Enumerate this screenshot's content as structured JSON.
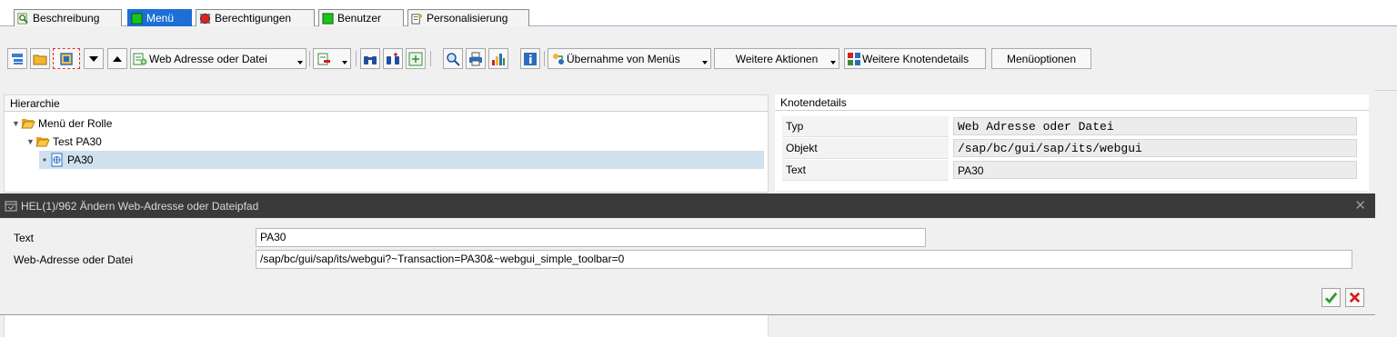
{
  "tabs": [
    {
      "label": "Beschreibung",
      "icon": "magnifier-doc-icon",
      "active": false
    },
    {
      "label": "Menü",
      "icon": "green-square-icon",
      "active": true
    },
    {
      "label": "Berechtigungen",
      "icon": "red-traffic-light-icon",
      "active": false
    },
    {
      "label": "Benutzer",
      "icon": "green-square-icon",
      "active": false
    },
    {
      "label": "Personalisierung",
      "icon": "personalization-icon",
      "active": false
    }
  ],
  "toolbar": {
    "web_label": "Web Adresse oder Datei",
    "uebernahme_label": "Übernahme von Menüs",
    "weitere_aktionen_label": "Weitere Aktionen",
    "weitere_knotendetails_label": "Weitere Knotendetails",
    "menueoptionen_label": "Menüoptionen"
  },
  "hierarchy": {
    "title": "Hierarchie",
    "nodes": [
      {
        "label": "Menü der Rolle",
        "type": "folder"
      },
      {
        "label": "Test PA30",
        "type": "folder"
      },
      {
        "label": "PA30",
        "type": "web-node",
        "selected": true
      }
    ]
  },
  "node_details": {
    "title": "Knotendetails",
    "rows": [
      {
        "label": "Typ",
        "value": "Web Adresse oder Datei"
      },
      {
        "label": "Objekt",
        "value": "/sap/bc/gui/sap/its/webgui"
      },
      {
        "label": "Text",
        "value": "PA30"
      }
    ]
  },
  "dialog": {
    "title": "HEL(1)/962 Ändern Web-Adresse oder Dateipfad",
    "text_label": "Text",
    "text_value": "PA30",
    "url_label": "Web-Adresse oder Datei",
    "url_value": "/sap/bc/gui/sap/its/webgui?~Transaction=PA30&~webgui_simple_toolbar=0"
  },
  "colors": {
    "active_tab": "#1c6fd6",
    "dialog_title_bg": "#3a3a3a",
    "selection": "#cfe0ef"
  }
}
